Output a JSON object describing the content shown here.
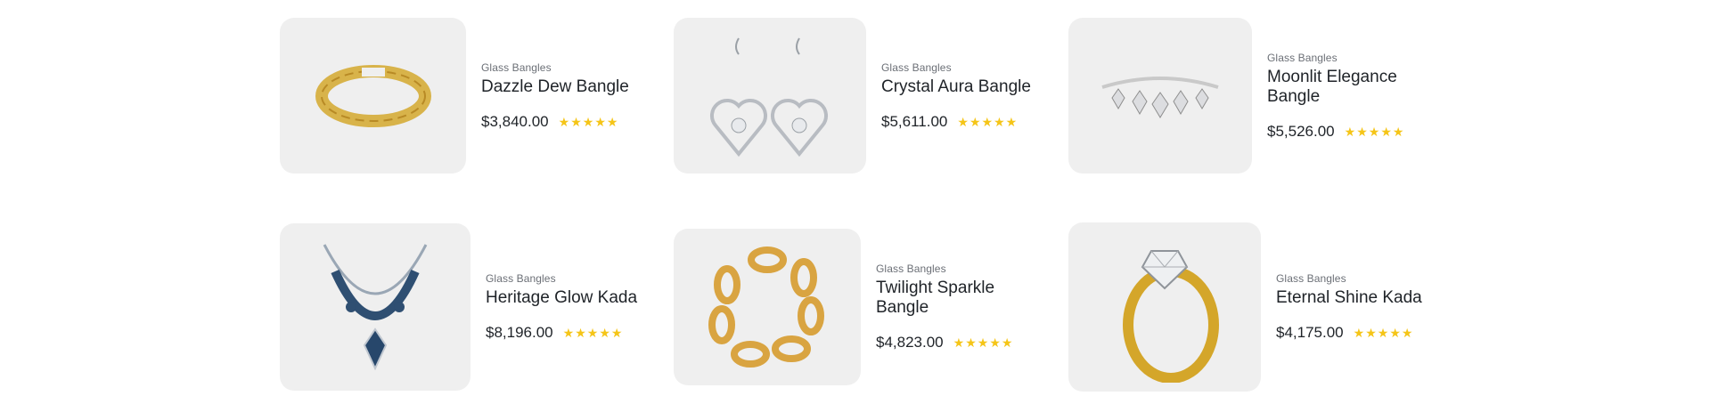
{
  "products": [
    {
      "category": "Glass Bangles",
      "title": "Dazzle Dew Bangle",
      "price": "$3,840.00",
      "rating": 5,
      "image": "gold-braided-cuff-bangle"
    },
    {
      "category": "Glass Bangles",
      "title": "Crystal Aura Bangle",
      "price": "$5,611.00",
      "rating": 5,
      "image": "silver-heart-earrings"
    },
    {
      "category": "Glass Bangles",
      "title": "Moonlit Elegance Bangle",
      "price": "$5,526.00",
      "rating": 5,
      "image": "diamond-bracelet"
    },
    {
      "category": "Glass Bangles",
      "title": "Heritage Glow Kada",
      "price": "$8,196.00",
      "rating": 5,
      "image": "sapphire-necklace"
    },
    {
      "category": "Glass Bangles",
      "title": "Twilight Sparkle Bangle",
      "price": "$4,823.00",
      "rating": 5,
      "image": "gold-chain-bracelet"
    },
    {
      "category": "Glass Bangles",
      "title": "Eternal Shine Kada",
      "price": "$4,175.00",
      "rating": 5,
      "image": "gold-diamond-ring"
    }
  ],
  "colors": {
    "thumb_bg": "#efefef",
    "star": "#f5c518",
    "text": "#1f2328",
    "muted": "#6b6f76"
  }
}
